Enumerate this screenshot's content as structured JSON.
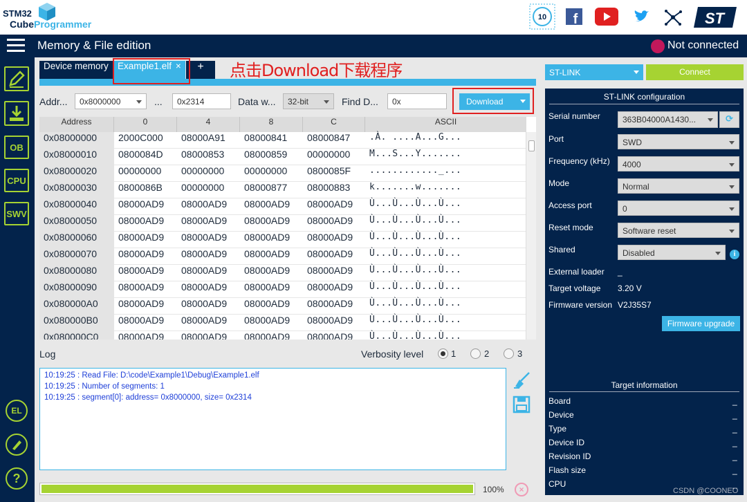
{
  "app": {
    "logo_line1": "STM32",
    "logo_line2_a": "Cube",
    "logo_line2_b": "Programmer"
  },
  "header_icons": [
    "anniversary-badge-icon",
    "facebook-icon",
    "youtube-icon",
    "twitter-icon",
    "network-icon",
    "st-logo"
  ],
  "titlebar": {
    "title": "Memory & File edition",
    "status": "Not connected"
  },
  "sidebar": {
    "items": [
      "edit-icon",
      "download-icon",
      "OB",
      "CPU",
      "SWV"
    ],
    "bottom_items": [
      "el-icon",
      "beta-icon",
      "help-icon"
    ]
  },
  "tabs": {
    "device_memory": "Device memory",
    "file_tab": "Example1.elf",
    "close": "×",
    "add": "+"
  },
  "annotation": {
    "text": "点击Download下载程序"
  },
  "toolbar": {
    "address_label": "Addr...",
    "address_value": "0x8000000",
    "ellipsis": "...",
    "size_value": "0x2314",
    "data_width_label": "Data w...",
    "data_width_value": "32-bit",
    "find_label": "Find D...",
    "find_value": "0x",
    "download_label": "Download"
  },
  "table": {
    "headers": [
      "Address",
      "0",
      "4",
      "8",
      "C",
      "ASCII"
    ],
    "rows": [
      [
        "0x08000000",
        "2000C000",
        "08000A91",
        "08000841",
        "08000847",
        ".À. ....A...G..."
      ],
      [
        "0x08000010",
        "0800084D",
        "08000853",
        "08000859",
        "00000000",
        "M...S...Y......."
      ],
      [
        "0x08000020",
        "00000000",
        "00000000",
        "00000000",
        "0800085F",
        "............_..."
      ],
      [
        "0x08000030",
        "0800086B",
        "00000000",
        "08000877",
        "08000883",
        "k.......w......."
      ],
      [
        "0x08000040",
        "08000AD9",
        "08000AD9",
        "08000AD9",
        "08000AD9",
        "Ù...Ù...Ù...Ù..."
      ],
      [
        "0x08000050",
        "08000AD9",
        "08000AD9",
        "08000AD9",
        "08000AD9",
        "Ù...Ù...Ù...Ù..."
      ],
      [
        "0x08000060",
        "08000AD9",
        "08000AD9",
        "08000AD9",
        "08000AD9",
        "Ù...Ù...Ù...Ù..."
      ],
      [
        "0x08000070",
        "08000AD9",
        "08000AD9",
        "08000AD9",
        "08000AD9",
        "Ù...Ù...Ù...Ù..."
      ],
      [
        "0x08000080",
        "08000AD9",
        "08000AD9",
        "08000AD9",
        "08000AD9",
        "Ù...Ù...Ù...Ù..."
      ],
      [
        "0x08000090",
        "08000AD9",
        "08000AD9",
        "08000AD9",
        "08000AD9",
        "Ù...Ù...Ù...Ù..."
      ],
      [
        "0x080000A0",
        "08000AD9",
        "08000AD9",
        "08000AD9",
        "08000AD9",
        "Ù...Ù...Ù...Ù..."
      ],
      [
        "0x080000B0",
        "08000AD9",
        "08000AD9",
        "08000AD9",
        "08000AD9",
        "Ù...Ù...Ù...Ù..."
      ],
      [
        "0x080000C0",
        "08000AD9",
        "08000AD9",
        "08000AD9",
        "08000AD9",
        "Ù...Ù...Ù...Ù..."
      ]
    ]
  },
  "log": {
    "title": "Log",
    "verbosity_label": "Verbosity level",
    "levels": [
      "1",
      "2",
      "3"
    ],
    "selected_level": "1",
    "lines": [
      "10:19:25 : Read File: D:\\code\\Example1\\Debug\\Example1.elf",
      "10:19:25 : Number of segments: 1",
      "10:19:25 : segment[0]: address= 0x8000000, size= 0x2314"
    ],
    "progress_fraction": 1.0,
    "progress_text": "100%"
  },
  "right_panel": {
    "interface": "ST-LINK",
    "connect_label": "Connect",
    "config_title": "ST-LINK configuration",
    "fields": [
      {
        "label": "Serial number",
        "value": "363B04000A1430..."
      },
      {
        "label": "Port",
        "value": "SWD"
      },
      {
        "label": "Frequency (kHz)",
        "value": "4000"
      },
      {
        "label": "Mode",
        "value": "Normal"
      },
      {
        "label": "Access port",
        "value": "0"
      },
      {
        "label": "Reset mode",
        "value": "Software reset"
      },
      {
        "label": "Shared",
        "value": "Disabled"
      }
    ],
    "external_loader_label": "External loader",
    "external_loader_value": "_",
    "target_voltage_label": "Target voltage",
    "target_voltage_value": "3.20 V",
    "firmware_version_label": "Firmware version",
    "firmware_version_value": "V2J35S7",
    "firmware_upgrade_label": "Firmware upgrade",
    "target_info_title": "Target information",
    "target_info": [
      {
        "label": "Board",
        "value": "_"
      },
      {
        "label": "Device",
        "value": "_"
      },
      {
        "label": "Type",
        "value": "_"
      },
      {
        "label": "Device ID",
        "value": "_"
      },
      {
        "label": "Revision ID",
        "value": "_"
      },
      {
        "label": "Flash size",
        "value": "_"
      },
      {
        "label": "CPU",
        "value": "_"
      }
    ]
  },
  "watermark": "CSDN @COONEO",
  "colors": {
    "navy": "#03234b",
    "blue": "#3cb4e6",
    "green": "#a6d332",
    "red_annotation": "#e02020",
    "log_text": "#1e3fd8"
  }
}
